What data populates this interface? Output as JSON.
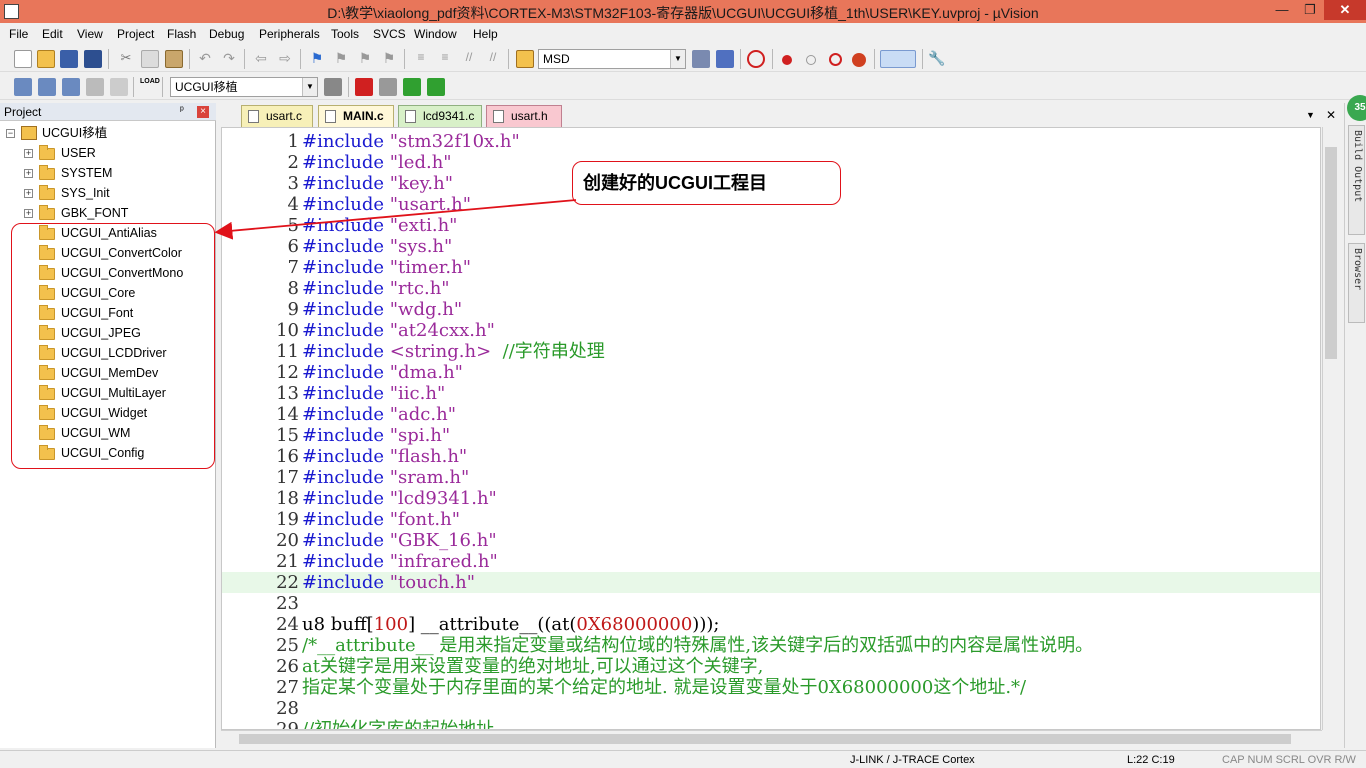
{
  "window": {
    "title": "D:\\教学\\xiaolong_pdf资料\\CORTEX-M3\\STM32F103-寄存器版\\UCGUI\\UCGUI移植_1th\\USER\\KEY.uvproj - µVision",
    "min": "—",
    "max": "❐",
    "close": "✕"
  },
  "menu": [
    "File",
    "Edit",
    "View",
    "Project",
    "Flash",
    "Debug",
    "Peripherals",
    "Tools",
    "SVCS",
    "Window",
    "Help"
  ],
  "toolbar": {
    "target_combo": "MSD",
    "project_combo": "UCGUI移植"
  },
  "project_panel": {
    "title": "Project",
    "pin": "ᵖ",
    "close": "×",
    "root": "UCGUI移植",
    "groups": [
      "USER",
      "SYSTEM",
      "SYS_Init",
      "GBK_FONT"
    ],
    "ucgui_groups": [
      "UCGUI_AntiAlias",
      "UCGUI_ConvertColor",
      "UCGUI_ConvertMono",
      "UCGUI_Core",
      "UCGUI_Font",
      "UCGUI_JPEG",
      "UCGUI_LCDDriver",
      "UCGUI_MemDev",
      "UCGUI_MultiLayer",
      "UCGUI_Widget",
      "UCGUI_WM",
      "UCGUI_Config"
    ],
    "expand_glyph": "+"
  },
  "tabs": [
    {
      "label": "usart.c"
    },
    {
      "label": "MAIN.c"
    },
    {
      "label": "lcd9341.c"
    },
    {
      "label": "usart.h"
    }
  ],
  "tab_controls": {
    "dropdown": "▼",
    "close": "✕"
  },
  "annotation": {
    "callout_text": "创建好的UCGUI工程目"
  },
  "code": [
    {
      "n": "1",
      "kw": "#include",
      "str": " \"stm32f10x.h\""
    },
    {
      "n": "2",
      "kw": "#include",
      "str": " \"led.h\""
    },
    {
      "n": "3",
      "kw": "#include",
      "str": " \"key.h\""
    },
    {
      "n": "4",
      "kw": "#include",
      "str": " \"usart.h\""
    },
    {
      "n": "5",
      "kw": "#include",
      "str": " \"exti.h\""
    },
    {
      "n": "6",
      "kw": "#include",
      "str": " \"sys.h\""
    },
    {
      "n": "7",
      "kw": "#include",
      "str": " \"timer.h\""
    },
    {
      "n": "8",
      "kw": "#include",
      "str": " \"rtc.h\""
    },
    {
      "n": "9",
      "kw": "#include",
      "str": " \"wdg.h\""
    },
    {
      "n": "10",
      "kw": "#include",
      "str": " \"at24cxx.h\""
    },
    {
      "n": "11",
      "kw": "#include",
      "str": " <string.h>",
      "cmt": "  //字符串处理"
    },
    {
      "n": "12",
      "kw": "#include",
      "str": " \"dma.h\""
    },
    {
      "n": "13",
      "kw": "#include",
      "str": " \"iic.h\""
    },
    {
      "n": "14",
      "kw": "#include",
      "str": " \"adc.h\""
    },
    {
      "n": "15",
      "kw": "#include",
      "str": " \"spi.h\""
    },
    {
      "n": "16",
      "kw": "#include",
      "str": " \"flash.h\""
    },
    {
      "n": "17",
      "kw": "#include",
      "str": " \"sram.h\""
    },
    {
      "n": "18",
      "kw": "#include",
      "str": " \"lcd9341.h\""
    },
    {
      "n": "19",
      "kw": "#include",
      "str": " \"font.h\""
    },
    {
      "n": "20",
      "kw": "#include",
      "str": " \"GBK_16.h\""
    },
    {
      "n": "21",
      "kw": "#include",
      "str": " \"infrared.h\""
    },
    {
      "n": "22",
      "kw": "#include",
      "str": " \"touch.h\"",
      "hl": true
    },
    {
      "n": "23"
    },
    {
      "n": "24",
      "plain": "u8 buff[",
      "num": "100",
      "plain2": "] __attribute__((at(",
      "num2": "0X68000000",
      "plain3": ")));"
    },
    {
      "n": "25",
      "cmt": "/*__attribute__ 是用来指定变量或结构位域的特殊属性,该关键字后的双括弧中的内容是属性说明。"
    },
    {
      "n": "26",
      "cmt": "at关键字是用来设置变量的绝对地址,可以通过这个关键字,"
    },
    {
      "n": "27",
      "cmt": "指定某个变量处于内存里面的某个给定的地址. 就是设置变量处于0X68000000这个地址.*/"
    },
    {
      "n": "28"
    },
    {
      "n": "29",
      "cmt": "//初始化字库的起始地址"
    }
  ],
  "right_sidebar": {
    "build_output": "Build Output",
    "browser": "Browser",
    "badge": "35"
  },
  "status": {
    "debugger": "J-LINK / J-TRACE Cortex",
    "position": "L:22 C:19",
    "flags": "CAP NUM SCRL OVR R/W"
  },
  "colors": {
    "titlebar": "#e8765a",
    "keyword": "#1a1ad0",
    "string": "#9a2a9a",
    "comment": "#2a9a2a",
    "annotation_red": "#e0121a"
  }
}
